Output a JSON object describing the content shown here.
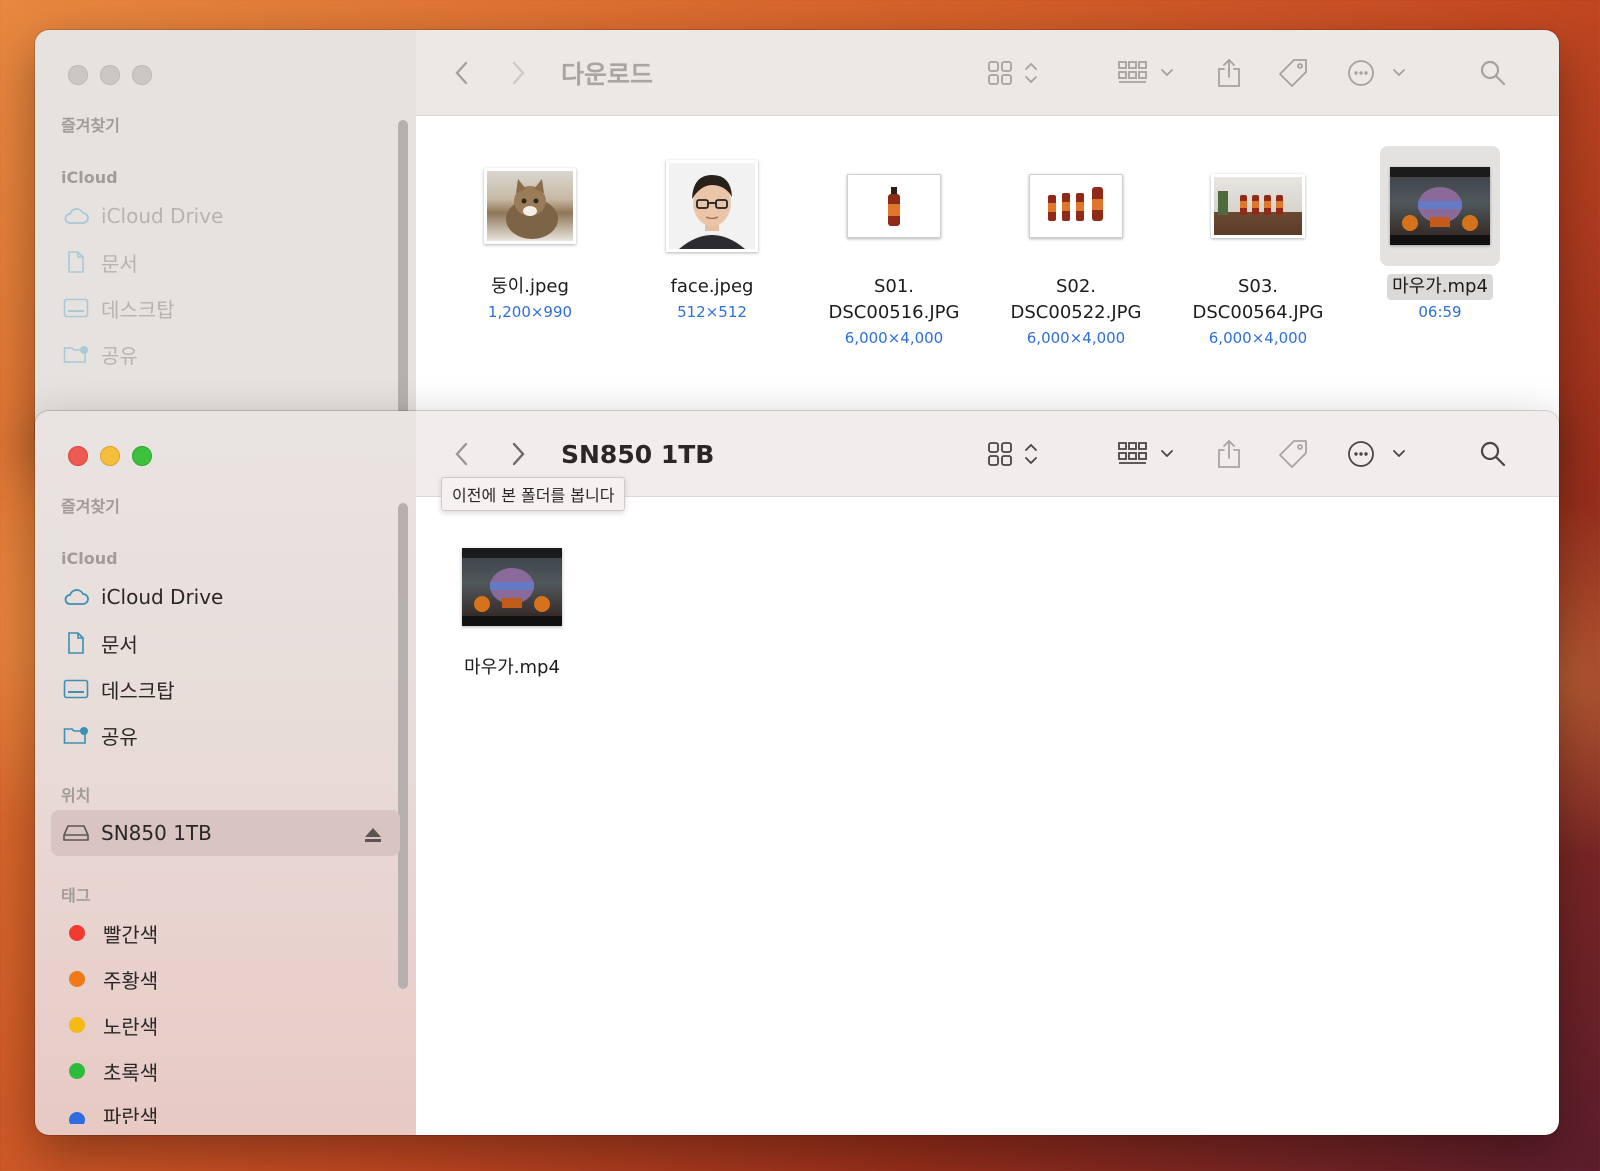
{
  "back_window": {
    "title": "다운로드",
    "sidebar": {
      "favorites_header": "즐겨찾기",
      "icloud_header": "iCloud",
      "items": [
        {
          "label": "iCloud Drive",
          "icon": "cloud-icon"
        },
        {
          "label": "문서",
          "icon": "document-icon"
        },
        {
          "label": "데스크탑",
          "icon": "desktop-icon"
        },
        {
          "label": "공유",
          "icon": "shared-folder-icon"
        }
      ]
    },
    "files": [
      {
        "name": "둥이.jpeg",
        "meta": "1,200×990",
        "thumb": "cat-photo"
      },
      {
        "name": "face.jpeg",
        "meta": "512×512",
        "thumb": "face-avatar"
      },
      {
        "name_line1": "S01.",
        "name_line2": "DSC00516.JPG",
        "meta": "6,000×4,000",
        "thumb": "one-bottle"
      },
      {
        "name_line1": "S02.",
        "name_line2": "DSC00522.JPG",
        "meta": "6,000×4,000",
        "thumb": "four-bottles"
      },
      {
        "name_line1": "S03.",
        "name_line2": "DSC00564.JPG",
        "meta": "6,000×4,000",
        "thumb": "bottles-on-table"
      },
      {
        "name": "마우가.mp4",
        "meta": "06:59",
        "thumb": "video-frame",
        "selected": true
      }
    ]
  },
  "front_window": {
    "title": "SN850 1TB",
    "tooltip": "이전에 본 폴더를 봅니다",
    "sidebar": {
      "favorites_header": "즐겨찾기",
      "icloud_header": "iCloud",
      "items": [
        {
          "label": "iCloud Drive",
          "icon": "cloud-icon"
        },
        {
          "label": "문서",
          "icon": "document-icon"
        },
        {
          "label": "데스크탑",
          "icon": "desktop-icon"
        },
        {
          "label": "공유",
          "icon": "shared-folder-icon"
        }
      ],
      "locations_header": "위치",
      "location": {
        "label": "SN850 1TB",
        "icon": "drive-icon",
        "eject_icon": "eject-icon"
      },
      "tags_header": "태그",
      "tags": [
        {
          "label": "빨간색",
          "color": "#f23b30"
        },
        {
          "label": "주황색",
          "color": "#f07a17"
        },
        {
          "label": "노란색",
          "color": "#f5b918"
        },
        {
          "label": "초록색",
          "color": "#2dbb3a"
        },
        {
          "label": "파란색",
          "color": "#2f6ce0"
        }
      ]
    },
    "files": [
      {
        "name": "마우가.mp4",
        "thumb": "video-frame"
      }
    ]
  },
  "colors": {
    "accent_blue": "#2d6fd6",
    "icon_teal": "#3c8fb5"
  }
}
